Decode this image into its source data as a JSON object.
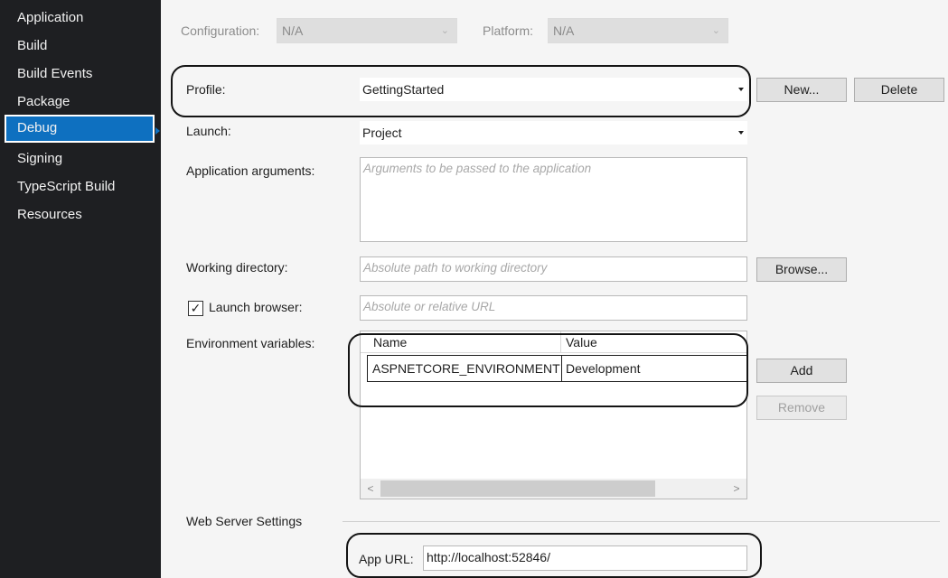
{
  "sidebar": {
    "items": [
      {
        "label": "Application"
      },
      {
        "label": "Build"
      },
      {
        "label": "Build Events"
      },
      {
        "label": "Package"
      },
      {
        "label": "Debug"
      },
      {
        "label": "Signing"
      },
      {
        "label": "TypeScript Build"
      },
      {
        "label": "Resources"
      }
    ],
    "active": "Debug",
    "active_color": "#0e70c0"
  },
  "top": {
    "configuration_label": "Configuration:",
    "configuration_value": "N/A",
    "platform_label": "Platform:",
    "platform_value": "N/A"
  },
  "profile": {
    "label": "Profile:",
    "value": "GettingStarted",
    "new_button": "New...",
    "delete_button": "Delete"
  },
  "launch": {
    "label": "Launch:",
    "value": "Project"
  },
  "app_args": {
    "label": "Application arguments:",
    "placeholder": "Arguments to be passed to the application"
  },
  "working_dir": {
    "label": "Working directory:",
    "placeholder": "Absolute path to working directory",
    "browse_button": "Browse..."
  },
  "launch_browser": {
    "label": "Launch browser:",
    "checked": true,
    "check_glyph": "✓",
    "placeholder": "Absolute or relative URL"
  },
  "env_vars": {
    "label": "Environment variables:",
    "columns": [
      "Name",
      "Value"
    ],
    "rows": [
      {
        "name": "ASPNETCORE_ENVIRONMENT",
        "value": "Development"
      }
    ],
    "add_button": "Add",
    "remove_button": "Remove",
    "scroll_left": "<",
    "scroll_right": ">"
  },
  "web_server": {
    "section_label": "Web Server Settings",
    "app_url_label": "App URL:",
    "app_url_value": "http://localhost:52846/"
  }
}
